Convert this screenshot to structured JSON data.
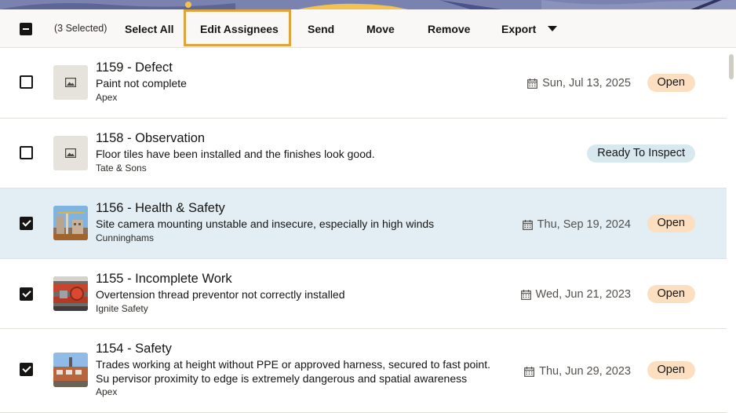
{
  "toolbar": {
    "selected_count": "(3 Selected)",
    "select_all": "Select All",
    "edit_assignees": "Edit Assignees",
    "send": "Send",
    "move": "Move",
    "remove": "Remove",
    "export": "Export"
  },
  "rows": [
    {
      "title": "1159 - Defect",
      "description": "Paint not complete",
      "company": "Apex",
      "date": "Sun, Jul 13, 2025",
      "status": "Open",
      "checked": false,
      "thumbnail": "placeholder-image-icon"
    },
    {
      "title": "1158 - Observation",
      "description": "Floor tiles have been installed and the finishes look good.",
      "company": "Tate & Sons",
      "date": "",
      "status": "Ready To Inspect",
      "checked": false,
      "thumbnail": "placeholder-image-icon"
    },
    {
      "title": "1156 - Health & Safety",
      "description": "Site camera mounting unstable and insecure, especially in high winds",
      "company": "Cunninghams",
      "date": "Thu, Sep 19, 2024",
      "status": "Open",
      "checked": true,
      "thumbnail": "construction-site-photo"
    },
    {
      "title": "1155 - Incomplete Work",
      "description": "Overtension thread preventor not correctly installed",
      "company": "Ignite Safety",
      "date": "Wed, Jun 21, 2023",
      "status": "Open",
      "checked": true,
      "thumbnail": "pipe-valve-photo"
    },
    {
      "title": "1154 - Safety",
      "description": "Trades working at height without PPE or approved harness, secured to fast point. Su pervisor proximity to edge is extremely dangerous and spatial awareness hamper…",
      "company": "Apex",
      "date": "Thu, Jun 29, 2023",
      "status": "Open",
      "checked": true,
      "thumbnail": "building-facade-photo"
    }
  ],
  "colors": {
    "selected_row": "#e3eef4",
    "open_badge": "#fbdfc0",
    "ready_badge": "#d8e8ef",
    "focus_outline": "#e3a33c"
  }
}
